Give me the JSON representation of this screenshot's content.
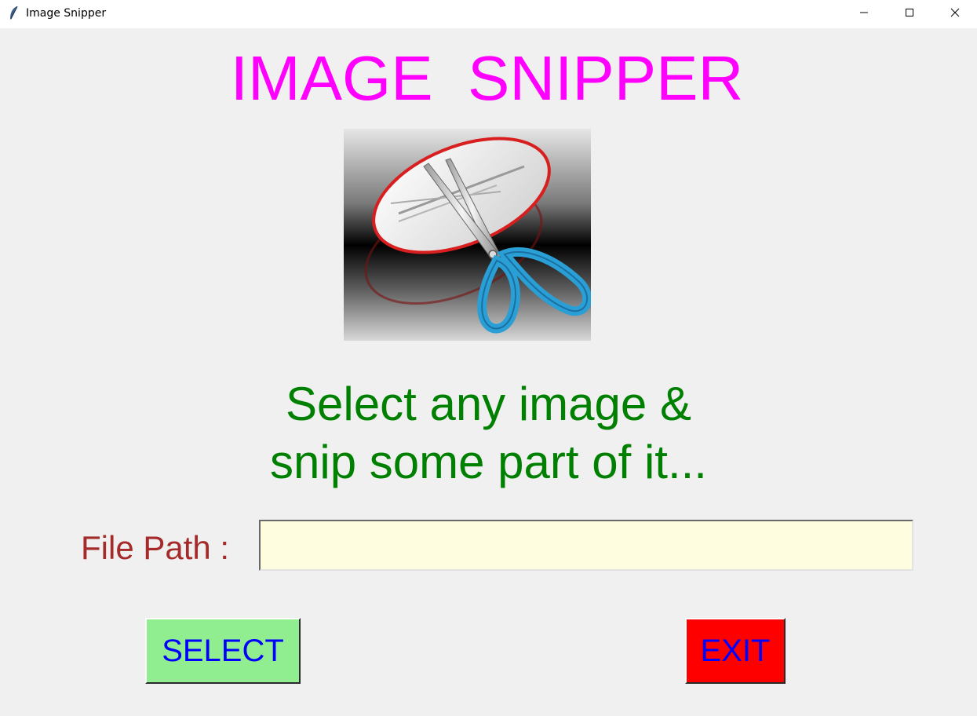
{
  "window": {
    "title": "Image Snipper",
    "icon": "feather-icon",
    "controls": {
      "minimize_icon": "minimize-icon",
      "maximize_icon": "maximize-icon",
      "close_icon": "close-icon"
    }
  },
  "main": {
    "title": "IMAGE  SNIPPER",
    "logo_icon": "scissors-snip-icon",
    "subtitle_line1": "Select any image &",
    "subtitle_line2": "snip some part of it...",
    "file_path_label": "File Path :",
    "file_path_value": "",
    "select_button": "SELECT",
    "exit_button": "EXIT"
  },
  "colors": {
    "background": "#f0f0f0",
    "title": "#ff00ff",
    "subtitle": "#008000",
    "label": "#a52a2a",
    "input_bg": "#fffde0",
    "select_bg": "#90ee90",
    "exit_bg": "#ff0000",
    "button_text": "#0000ff"
  }
}
